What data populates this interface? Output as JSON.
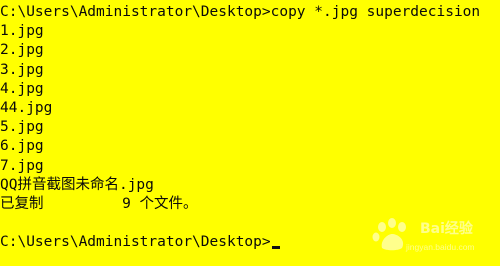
{
  "console": {
    "lines": [
      "C:\\Users\\Administrator\\Desktop>copy *.jpg superdecision",
      "1.jpg",
      "2.jpg",
      "3.jpg",
      "4.jpg",
      "44.jpg",
      "5.jpg",
      "6.jpg",
      "7.jpg",
      "QQ拼音截图未命名.jpg",
      "已复制         9 个文件。"
    ],
    "prompt": "C:\\Users\\Administrator\\Desktop>"
  },
  "colors": {
    "background": "#ffff00",
    "text": "#0a0a0a"
  },
  "watermark": {
    "brand": "Bai",
    "brand_cn": "经验",
    "url": "jingyan.baidu.com",
    "icon": "baidu-paw-icon"
  }
}
